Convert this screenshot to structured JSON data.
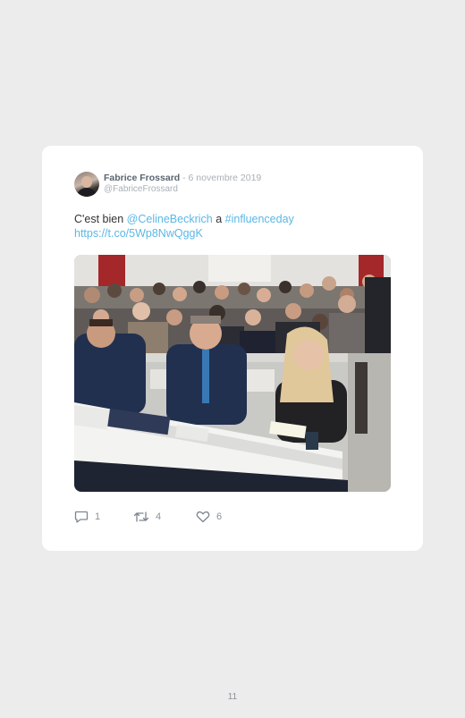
{
  "tweet": {
    "author_name": "Fabrice Frossard",
    "date_separator": " - ",
    "date": "6 novembre 2019",
    "handle": "@FabriceFrossard",
    "text_prefix": "C'est bien ",
    "mention": "@CelineBeckrich",
    "text_middle": " a ",
    "hashtag": "#influenceday",
    "link": "https://t.co/5Wp8NwQggK",
    "actions": {
      "reply_icon": "reply-icon",
      "reply_count": "1",
      "retweet_icon": "retweet-icon",
      "retweet_count": "4",
      "like_icon": "heart-icon",
      "like_count": "6"
    }
  },
  "page": {
    "number": "11"
  },
  "colors": {
    "link": "#5ab7e6",
    "author": "#5a6470",
    "muted": "#a9b0b7",
    "background": "#ececec",
    "card": "#ffffff"
  }
}
